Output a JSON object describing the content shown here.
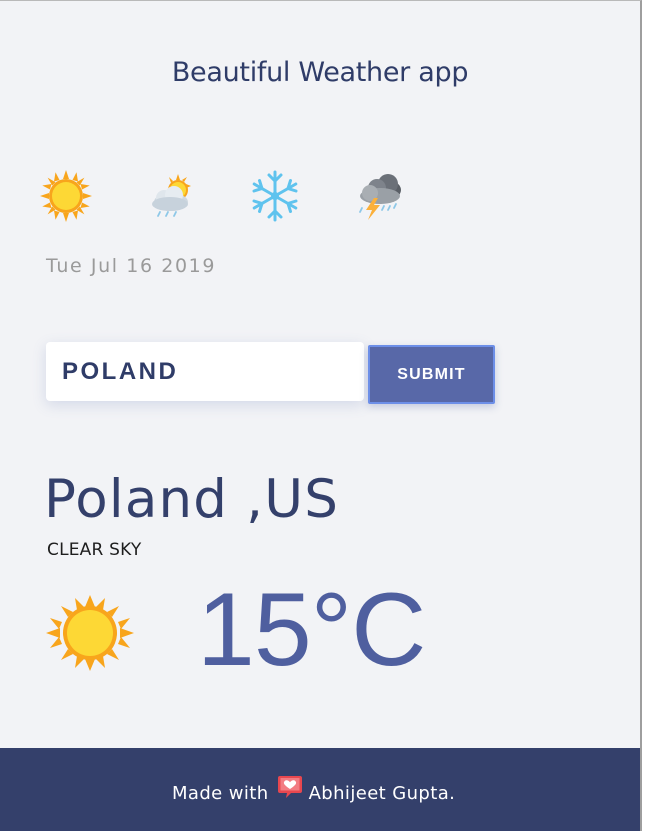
{
  "app": {
    "title": "Beautiful Weather app"
  },
  "icons_row": [
    {
      "icon": "sun-icon"
    },
    {
      "icon": "partly-cloudy-icon"
    },
    {
      "icon": "snowflake-icon"
    },
    {
      "icon": "thunderstorm-icon"
    }
  ],
  "date": "Tue Jul 16 2019",
  "search": {
    "value": "POLAND",
    "placeholder": "",
    "submit_label": "SUBMIT"
  },
  "result": {
    "city": "Poland ,US",
    "condition": "CLEAR SKY",
    "icon": "sun-icon",
    "temperature": "15°C"
  },
  "footer": {
    "text_before": "Made with",
    "icon": "speech-heart-icon",
    "author": "Abhijeet Gupta."
  },
  "colors": {
    "background": "#f2f3f6",
    "primary": "#34406b",
    "accent": "#5868a8",
    "temperature": "#4f5f9f",
    "sun": "#fdd835",
    "sun_rays": "#f8a51c"
  }
}
